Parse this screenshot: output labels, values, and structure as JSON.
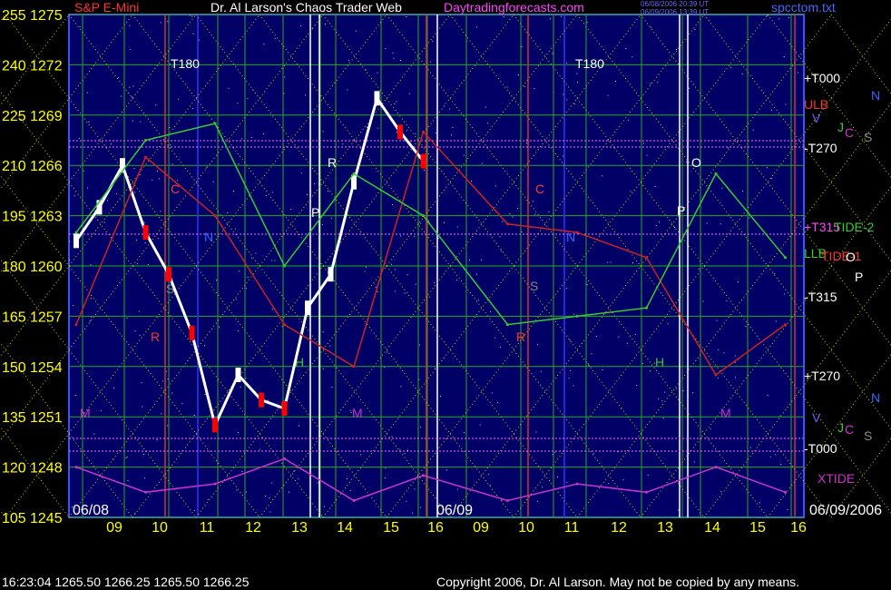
{
  "header": {
    "instrument": "S&P E-Mini",
    "title": "Dr. Al Larson's Chaos Trader Web",
    "site": "Daytradingforecasts.com",
    "stamp1": "06/08/2006 20:39 UT",
    "stamp2": "06/09/2006 13:39 UT",
    "file": "spcctom.txt"
  },
  "footer": {
    "quote": "16:23:04  1265.50 1266.25 1265.50 1266.25",
    "copyright": "Copyright 2006, Dr. Al Larson. May not be copied by any means."
  },
  "colors": {
    "background": "#000000",
    "panel": "#000066",
    "price_bars": "#ffffff",
    "down_bars": "#ff0000",
    "flux_green": "#33cc33",
    "flux_red": "#cc2222",
    "xtide": "#cc33cc",
    "grid_yellow": "#cccc00",
    "axis_text": "#ffff00"
  },
  "chart_data": {
    "type": "line",
    "title": "S&P E-Mini",
    "left_axis_ticks": [
      "255",
      "240",
      "225",
      "210",
      "195",
      "180",
      "165",
      "150",
      "135",
      "120",
      "105"
    ],
    "price_ticks": [
      "1275",
      "1272",
      "1269",
      "1266",
      "1263",
      "1260",
      "1257",
      "1254",
      "1251",
      "1248",
      "1245"
    ],
    "ylim": [
      1245,
      1275
    ],
    "x_tick_labels": [
      "09",
      "10",
      "11",
      "12",
      "13",
      "14",
      "15",
      "16",
      "09",
      "10",
      "11",
      "12",
      "13",
      "14",
      "15",
      "16"
    ],
    "date_labels": [
      "06/08",
      "06/09",
      "06/09/2006"
    ],
    "right_labels": [
      "+T000",
      "ULB",
      "-T270",
      "+T315",
      "TIDE-2",
      "LLB",
      "TIDE-1",
      "-T315",
      "+T270",
      "-T000",
      "XTIDE"
    ],
    "planet_markers": [
      "O",
      "P",
      "C",
      "N",
      "S",
      "R",
      "H",
      "M",
      "V",
      "J"
    ],
    "grid_marker": "T180",
    "series": [
      {
        "name": "S&P E-Mini",
        "x": [
          "06/08 08:30",
          "06/08 09:00",
          "06/08 09:30",
          "06/08 10:00",
          "06/08 10:30",
          "06/08 11:00",
          "06/08 11:30",
          "06/08 12:00",
          "06/08 12:30",
          "06/08 13:00",
          "06/08 13:30",
          "06/08 14:00",
          "06/08 14:30",
          "06/08 15:00",
          "06/08 15:30",
          "06/08 16:00"
        ],
        "y": [
          1261.5,
          1263.5,
          1266.0,
          1262.0,
          1259.5,
          1256.0,
          1250.5,
          1253.5,
          1252.0,
          1251.5,
          1257.5,
          1259.5,
          1265.0,
          1270.0,
          1268.0,
          1266.25
        ]
      },
      {
        "name": "TIDE-1",
        "x": [
          "06/08 08:30",
          "06/08 10:00",
          "06/08 11:30",
          "06/08 13:00",
          "06/08 14:30",
          "06/08 16:00",
          "06/09 10:00",
          "06/09 11:30",
          "06/09 13:00",
          "06/09 14:30",
          "06/09 16:00"
        ],
        "y": [
          1256.5,
          1266.5,
          1263.0,
          1256.5,
          1254.0,
          1268.0,
          1262.5,
          1262.0,
          1260.5,
          1253.5,
          1256.5
        ]
      },
      {
        "name": "TIDE-2",
        "x": [
          "06/08 08:30",
          "06/08 10:00",
          "06/08 11:30",
          "06/08 13:00",
          "06/08 14:30",
          "06/08 16:00",
          "06/09 10:00",
          "06/09 11:30",
          "06/09 13:00",
          "06/09 14:30",
          "06/09 16:00"
        ],
        "y": [
          1262.0,
          1267.5,
          1268.5,
          1260.0,
          1265.5,
          1263.0,
          1256.5,
          1257.0,
          1257.5,
          1265.5,
          1260.5
        ]
      },
      {
        "name": "XTIDE",
        "x": [
          "06/08 08:30",
          "06/08 10:00",
          "06/08 11:30",
          "06/08 13:00",
          "06/08 14:30",
          "06/08 16:00",
          "06/09 10:00",
          "06/09 11:30",
          "06/09 13:00",
          "06/09 14:30",
          "06/09 16:00"
        ],
        "y": [
          1248.0,
          1246.5,
          1247.0,
          1248.5,
          1246.0,
          1247.5,
          1246.0,
          1247.0,
          1246.5,
          1248.0,
          1246.5
        ]
      }
    ]
  }
}
